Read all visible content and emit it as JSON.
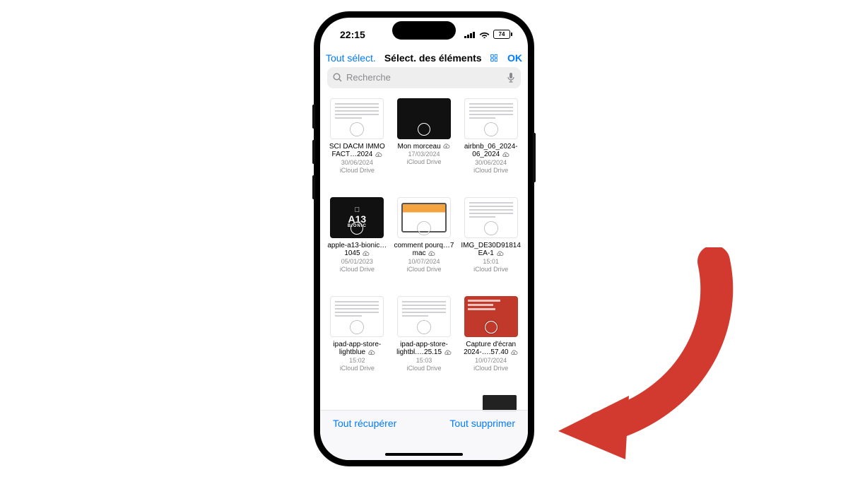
{
  "status": {
    "time": "22:15",
    "battery": "74"
  },
  "nav": {
    "select_all": "Tout sélect.",
    "title": "Sélect. des éléments",
    "done": "OK"
  },
  "search": {
    "placeholder": "Recherche"
  },
  "files": [
    {
      "name": "SCI DACM IMMO FACT…2024",
      "date": "30/06/2024",
      "loc": "iCloud Drive",
      "kind": "doc"
    },
    {
      "name": "Mon morceau",
      "date": "17/03/2024",
      "loc": "iCloud Drive",
      "kind": "dark"
    },
    {
      "name": "airbnb_06_2024-06_2024",
      "date": "30/06/2024",
      "loc": "iCloud Drive",
      "kind": "doc"
    },
    {
      "name": "apple-a13-bionic…1045",
      "date": "05/01/2023",
      "loc": "iCloud Drive",
      "kind": "a13"
    },
    {
      "name": "comment pourq…7 mac",
      "date": "10/07/2024",
      "loc": "iCloud Drive",
      "kind": "mac"
    },
    {
      "name": "IMG_DE30D91814EA-1",
      "date": "15:01",
      "loc": "iCloud Drive",
      "kind": "doc"
    },
    {
      "name": "ipad-app-store-lightblue",
      "date": "15:02",
      "loc": "iCloud Drive",
      "kind": "doc"
    },
    {
      "name": "ipad-app-store-lightbl.…25.15",
      "date": "15:03",
      "loc": "iCloud Drive",
      "kind": "doc"
    },
    {
      "name": "Capture d'écran 2024-….57.40",
      "date": "10/07/2024",
      "loc": "iCloud Drive",
      "kind": "red"
    }
  ],
  "bottom": {
    "recover": "Tout récupérer",
    "delete": "Tout supprimer"
  },
  "colors": {
    "accent": "#007aff",
    "arrow": "#d33a2f"
  }
}
